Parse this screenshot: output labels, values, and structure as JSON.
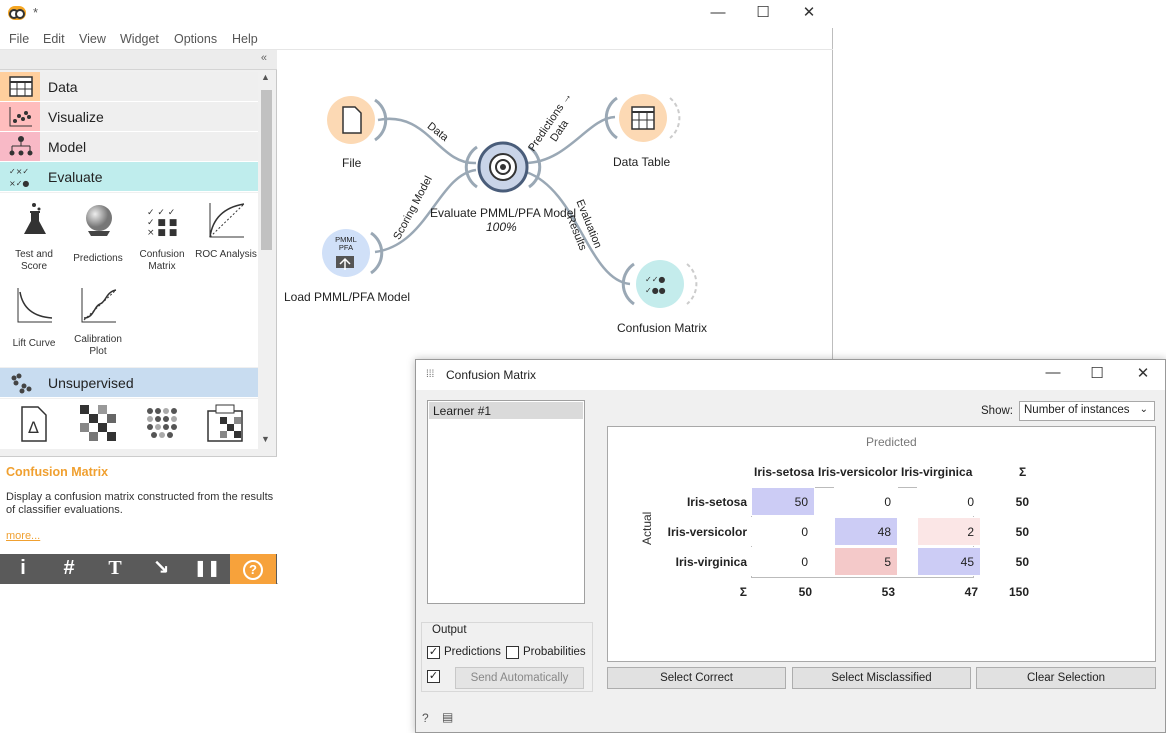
{
  "main_window": {
    "title": "*",
    "controls": {
      "minimize": "—",
      "maximize": "☐",
      "close": "✕"
    },
    "menu": [
      "File",
      "Edit",
      "View",
      "Widget",
      "Options",
      "Help"
    ]
  },
  "toolbox": {
    "collapse": "«",
    "categories": [
      "Data",
      "Visualize",
      "Model",
      "Evaluate",
      "Unsupervised"
    ],
    "evaluate_widgets": [
      {
        "label": "Test and Score",
        "icon": "flask-icon"
      },
      {
        "label": "Predictions",
        "icon": "crystal-ball-icon"
      },
      {
        "label": "Confusion Matrix",
        "icon": "confusion-matrix-icon"
      },
      {
        "label": "ROC Analysis",
        "icon": "roc-curve-icon"
      },
      {
        "label": "Lift Curve",
        "icon": "lift-curve-icon"
      },
      {
        "label": "Calibration Plot",
        "icon": "calibration-plot-icon"
      }
    ]
  },
  "help": {
    "title": "Confusion Matrix",
    "text": "Display a confusion matrix constructed from the results of classifier evaluations.",
    "more": "more..."
  },
  "bottom_toolbar": {
    "info": "i",
    "grid": "#",
    "text": "T",
    "arrow": "↘",
    "pause": "❚❚",
    "help": "?"
  },
  "canvas": {
    "nodes": {
      "file": "File",
      "data_table": "Data Table",
      "evaluate": "Evaluate PMML/PFA Model",
      "evaluate_progress": "100%",
      "load_model": "Load PMML/PFA Model",
      "load_model_badge": "PMML PFA",
      "confusion_matrix": "Confusion Matrix"
    },
    "links": {
      "file_eval": "Data",
      "eval_table_1": "Predictions →",
      "eval_table_2": "Data",
      "load_eval": "Scoring Model",
      "eval_cm_1": "Evaluation",
      "eval_cm_2": "Results"
    }
  },
  "cm_window": {
    "title": "Confusion Matrix",
    "controls": {
      "minimize": "—",
      "maximize": "☐",
      "close": "✕"
    },
    "learner": "Learner #1",
    "output_title": "Output",
    "predictions_label": "Predictions",
    "probabilities_label": "Probabilities",
    "send_button": "Send Automatically",
    "show_label": "Show:",
    "show_value": "Number of instances",
    "predicted_label": "Predicted",
    "actual_label": "Actual",
    "classes": [
      "Iris-setosa",
      "Iris-versicolor",
      "Iris-virginica"
    ],
    "sum_symbol": "Σ",
    "matrix": [
      [
        50,
        0,
        0
      ],
      [
        0,
        48,
        2
      ],
      [
        0,
        5,
        45
      ]
    ],
    "row_sums": [
      50,
      50,
      50
    ],
    "col_sums": [
      50,
      53,
      47
    ],
    "total": 150,
    "buttons": {
      "select_correct": "Select Correct",
      "select_misclassified": "Select Misclassified",
      "clear_selection": "Clear Selection"
    },
    "colors": {
      "correct_strong": "#ccccf5",
      "correct_light": "#ffffff",
      "error_light": "#fbe6e6",
      "error_strong": "#f4c9c9"
    }
  }
}
